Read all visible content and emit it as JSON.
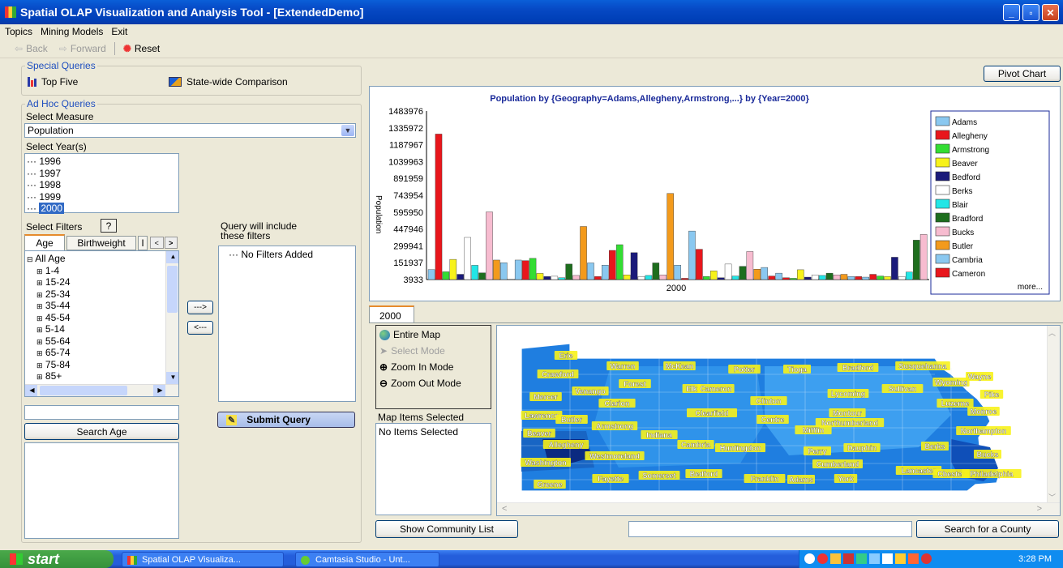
{
  "window": {
    "title": "Spatial OLAP Visualization and Analysis Tool - [ExtendedDemo]"
  },
  "menu": [
    "Topics",
    "Mining Models",
    "Exit"
  ],
  "toolbar": {
    "back": "Back",
    "forward": "Forward",
    "reset": "Reset"
  },
  "special_queries": {
    "legend": "Special Queries",
    "top_five": "Top Five",
    "statewide": "State-wide Comparison"
  },
  "adhoc": {
    "legend": "Ad Hoc Queries",
    "select_measure": "Select Measure",
    "measure_value": "Population",
    "select_years": "Select Year(s)",
    "years": [
      "1996",
      "1997",
      "1998",
      "1999",
      "2000"
    ],
    "selected_year": "2000",
    "select_filters": "Select Filters",
    "help": "?",
    "tabs": [
      "Age",
      "Birthweight",
      "I"
    ],
    "age_root": "All Age",
    "age_items": [
      "1-4",
      "15-24",
      "25-34",
      "35-44",
      "45-54",
      "5-14",
      "55-64",
      "65-74",
      "75-84",
      "85+"
    ],
    "query_include": "Query will include these filters",
    "no_filters": "No Filters Added",
    "add_btn": "--->",
    "remove_btn": "<---",
    "submit": "Submit Query",
    "search_age": "Search Age"
  },
  "pivot_chart": "Pivot Chart",
  "chart_data": {
    "type": "bar",
    "title": "Population by {Geography=Adams,Allegheny,Armstrong,...} by {Year=2000}",
    "ylabel": "Population",
    "categories": [
      "2000"
    ],
    "yticks": [
      "1483976",
      "1335972",
      "1187967",
      "1039963",
      "891959",
      "743954",
      "595950",
      "447946",
      "299941",
      "151937",
      "3933"
    ],
    "ylim": [
      3933,
      1483976
    ],
    "legend_more": "more...",
    "series": [
      {
        "name": "Adams",
        "color": "#8ac8f0",
        "values": [
          91000
        ]
      },
      {
        "name": "Allegheny",
        "color": "#e8161c",
        "values": [
          1281666
        ]
      },
      {
        "name": "Armstrong",
        "color": "#33dd33",
        "values": [
          72000
        ]
      },
      {
        "name": "Beaver",
        "color": "#f7f21b",
        "values": [
          181000
        ]
      },
      {
        "name": "Bedford",
        "color": "#1a1a7a",
        "values": [
          50000
        ]
      },
      {
        "name": "Berks",
        "color": "#ffffff",
        "values": [
          374000
        ]
      },
      {
        "name": "Blair",
        "color": "#22e6e6",
        "values": [
          129000
        ]
      },
      {
        "name": "Bradford",
        "color": "#1e6e1e",
        "values": [
          63000
        ]
      },
      {
        "name": "Bucks",
        "color": "#f7bcd0",
        "values": [
          598000
        ]
      },
      {
        "name": "Butler",
        "color": "#f39a1c",
        "values": [
          175000
        ]
      },
      {
        "name": "Cambria",
        "color": "#8ac8f0",
        "values": [
          152000
        ]
      },
      {
        "name": "Cameron",
        "color": "#e8161c",
        "values": [
          6000
        ]
      }
    ]
  },
  "map": {
    "tab": "2000",
    "entire_map": "Entire Map",
    "select_mode": "Select Mode",
    "zoom_in": "Zoom In Mode",
    "zoom_out": "Zoom Out Mode",
    "items_selected_label": "Map Items Selected",
    "no_items": "No Items Selected",
    "show_community": "Show Community List",
    "search_county": "Search for a County",
    "counties": [
      "Erie",
      "Warren",
      "McKean",
      "Potter",
      "Tioga",
      "Bradford",
      "Susquehanna",
      "Wayne",
      "Crawford",
      "Forest",
      "Elk",
      "Cameron",
      "Wyoming",
      "Venango",
      "Sullivan",
      "Lycoming",
      "Clinton",
      "Pike",
      "Mercer",
      "Clarion",
      "Luzerne",
      "Lawrence",
      "Butler",
      "Clearfield",
      "Centre",
      "Montour",
      "Monroe",
      "Armstrong",
      "Northumberland",
      "Beaver",
      "Indiana",
      "Northampton",
      "Allegheny",
      "Cambria",
      "Huntingdon",
      "Mifflin",
      "Perry",
      "Dauphin",
      "Berks",
      "Bucks",
      "Westmoreland",
      "Washington",
      "Cumberland",
      "Lancaster",
      "Chester",
      "Philadelphia",
      "Somerset",
      "Bedford",
      "Franklin",
      "Adams",
      "York",
      "Fayette",
      "Greene"
    ]
  },
  "taskbar": {
    "start": "start",
    "task1": "Spatial OLAP Visualiza...",
    "task2": "Camtasia Studio - Unt...",
    "clock": "3:28 PM"
  }
}
